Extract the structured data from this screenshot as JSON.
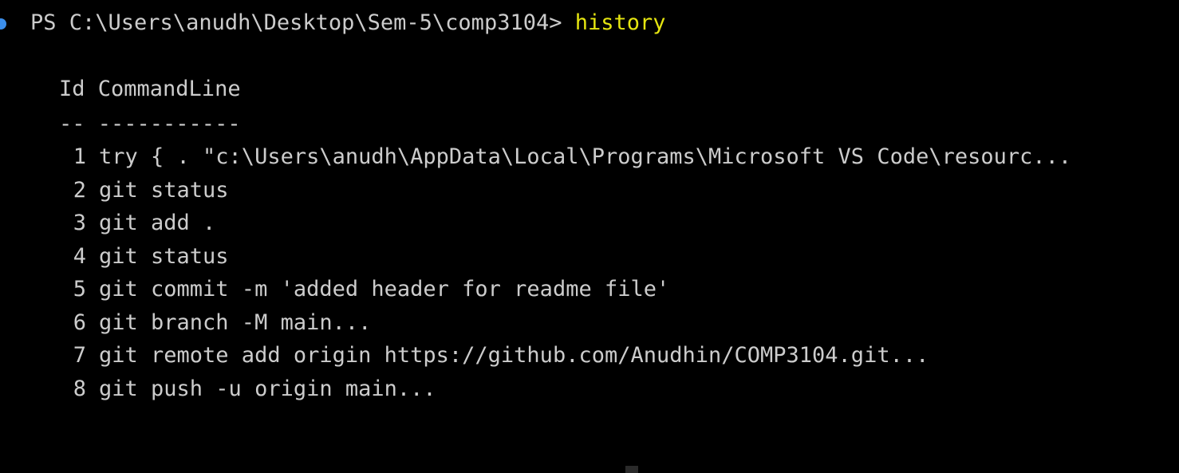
{
  "colors": {
    "background": "#000000",
    "foreground": "#cccccc",
    "command": "#e5e510",
    "prompt_dot": "#3b8eea"
  },
  "icons": {
    "prompt_status": "prompt-status-dot-icon"
  },
  "prompt": {
    "text": "PS C:\\Users\\anudh\\Desktop\\Sem-5\\comp3104> ",
    "command": "history"
  },
  "table": {
    "header_line": "Id CommandLine",
    "separator_line": "-- -----------",
    "rows": [
      {
        "id": "1",
        "command": "try { . \"c:\\Users\\anudh\\AppData\\Local\\Programs\\Microsoft VS Code\\resourc..."
      },
      {
        "id": "2",
        "command": "git status"
      },
      {
        "id": "3",
        "command": "git add ."
      },
      {
        "id": "4",
        "command": "git status"
      },
      {
        "id": "5",
        "command": "git commit -m 'added header for readme file'"
      },
      {
        "id": "6",
        "command": "git branch -M main..."
      },
      {
        "id": "7",
        "command": "git remote add origin https://github.com/Anudhin/COMP3104.git..."
      },
      {
        "id": "8",
        "command": "git push -u origin main..."
      }
    ]
  }
}
